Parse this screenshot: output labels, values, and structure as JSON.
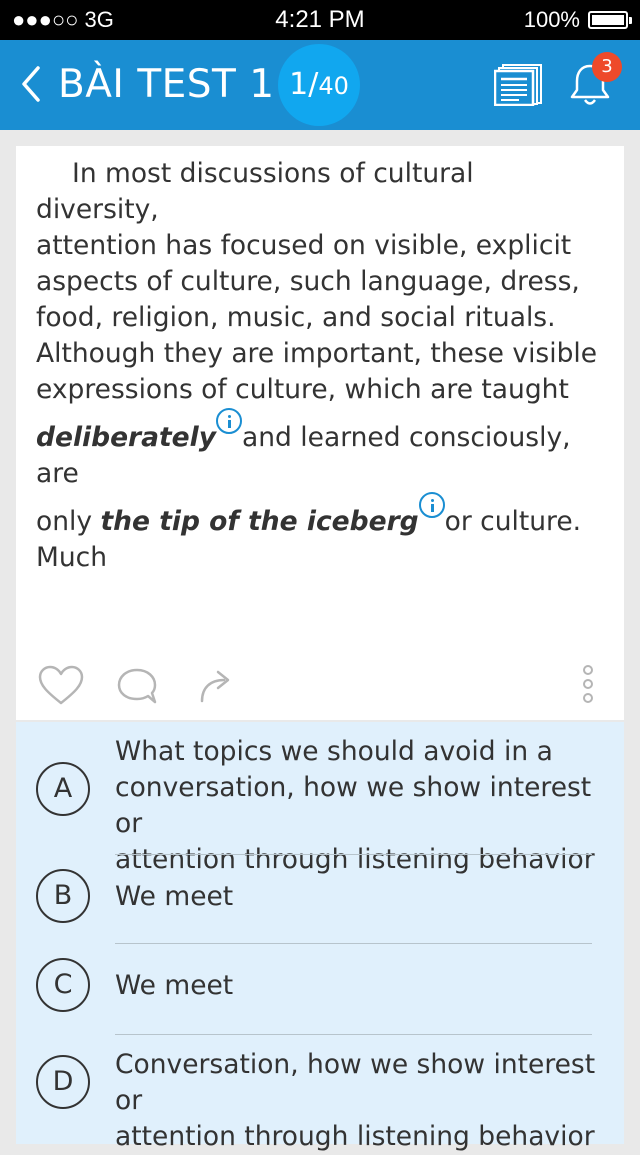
{
  "status_bar": {
    "carrier": "●●●○○ 3G",
    "time": "4:21 PM",
    "battery": "100%"
  },
  "header": {
    "title": "BÀI TEST 1",
    "counter_current": "1/",
    "counter_total": "40",
    "notification_count": "3"
  },
  "passage": {
    "lines": [
      "In most discussions of cultural diversity,",
      "attention has focused on visible, explicit",
      "aspects of culture, such language, dress,",
      "food, religion, music, and social rituals.",
      "Although they are important, these visible",
      "expressions of culture, which are taught"
    ],
    "line7_term": "deliberately",
    "line7_rest": "and learned consciously, are",
    "line8_start": "only ",
    "line8_term": "the tip of the iceberg",
    "line8_rest": "or culture. Much"
  },
  "options": [
    {
      "letter": "A",
      "lines": [
        "What topics we should avoid in a",
        "conversation, how we show interest or",
        "attention through listening behavior"
      ]
    },
    {
      "letter": "B",
      "lines": [
        "We meet"
      ]
    },
    {
      "letter": "C",
      "lines": [
        "We meet"
      ]
    },
    {
      "letter": "D",
      "lines": [
        "Conversation, how we show interest or",
        "attention through listening behavior"
      ]
    }
  ],
  "icons": {
    "back": "chevron-left-icon",
    "document": "document-stack-icon",
    "notifications": "bell-icon",
    "like": "heart-icon",
    "comment": "comment-bubble-icon",
    "share": "share-arrow-icon",
    "more": "more-vertical-icon",
    "info": "info-icon"
  },
  "colors": {
    "header_bg": "#1a8ed2",
    "counter_bg": "#11a7ef",
    "badge": "#ee4a2a",
    "answers_bg": "#e0f0fc"
  }
}
